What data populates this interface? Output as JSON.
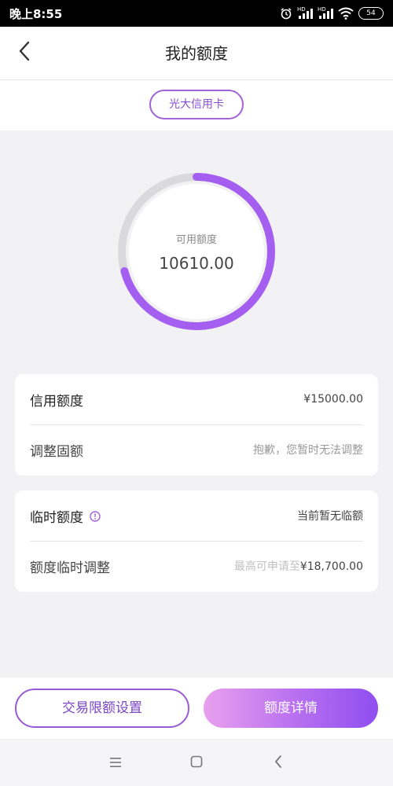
{
  "status_bar": {
    "time": "晚上8:55",
    "network_1": "HD",
    "network_2": "HD",
    "battery": "54"
  },
  "header": {
    "title": "我的额度",
    "back_icon": "chevron-left-icon"
  },
  "card_selector": {
    "label": "光大信用卡"
  },
  "ring": {
    "label": "可用额度",
    "value": "10610.00",
    "fraction": 0.7073,
    "colors": {
      "fill": "#a45ff0",
      "track": "#d9d9de"
    }
  },
  "credit_card": {
    "rows": [
      {
        "label": "信用额度",
        "value": "¥15000.00"
      },
      {
        "label": "调整固额",
        "value": "抱歉，您暂时无法调整"
      }
    ]
  },
  "temp_card": {
    "rows": [
      {
        "label": "临时额度",
        "value": "当前暂无临额",
        "icon": "info-icon"
      },
      {
        "label": "额度临时调整",
        "value_prefix": "最高可申请至",
        "value": "¥18,700.00"
      }
    ]
  },
  "actions": {
    "limit_settings": "交易限额设置",
    "limit_details": "额度详情"
  },
  "nav_bar": {
    "menu_icon": "menu-icon",
    "home_icon": "home-icon",
    "back_icon": "back-icon"
  },
  "colors": {
    "accent": "#a064d8",
    "gradient_start": "#e9a0ee",
    "gradient_end": "#8f4ef0"
  }
}
